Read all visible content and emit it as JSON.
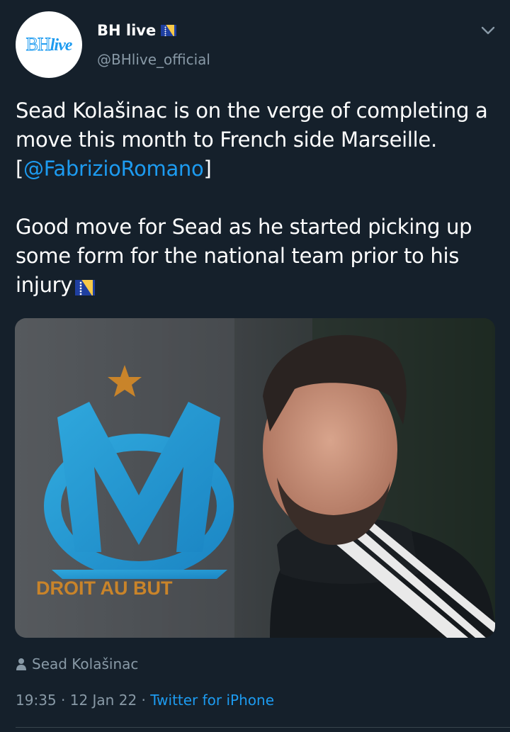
{
  "author": {
    "display_name": "BH live",
    "username": "@BHlive_official",
    "avatar_text_bh": "BH",
    "avatar_text_live": "live"
  },
  "tweet": {
    "line1": "Sead Kolašinac is on the verge of completing a move this month to French side Marseille.",
    "bracket_open": "[",
    "mention": "@FabrizioRomano",
    "bracket_close": "]",
    "paragraph2": "Good move for Sead as he started picking up some form for the national team prior to his injury"
  },
  "media": {
    "logo_motto": "DROIT AU BUT"
  },
  "tagged": {
    "person": "Sead Kolašinac"
  },
  "meta": {
    "time": "19:35",
    "sep1": " · ",
    "date": "12 Jan 22",
    "sep2": " · ",
    "source": "Twitter for iPhone"
  },
  "icons": {
    "flag": "bosnia-flag-icon",
    "menu": "chevron-down-icon",
    "tag": "person-icon"
  },
  "colors": {
    "background": "#15202b",
    "link": "#1d9bf0",
    "secondary_text": "#8899a6",
    "divider": "#38444d"
  }
}
